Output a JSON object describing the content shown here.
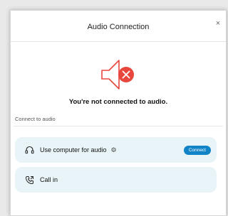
{
  "dialog": {
    "title": "Audio Connection",
    "close_glyph": "×"
  },
  "status": {
    "message": "You're not connected to audio.",
    "icon": "speaker-muted-icon",
    "accent_color": "#e8473e"
  },
  "section": {
    "label": "Connect to audio"
  },
  "options": [
    {
      "label": "Use computer for audio",
      "icon": "headset-icon",
      "settings_icon": "gear-icon",
      "settings_glyph": "⚙",
      "button_label": "Connect"
    },
    {
      "label": "Call in",
      "icon": "phone-icon"
    }
  ],
  "colors": {
    "option_background": "#e8f4f7",
    "button_background": "#1283c7"
  }
}
